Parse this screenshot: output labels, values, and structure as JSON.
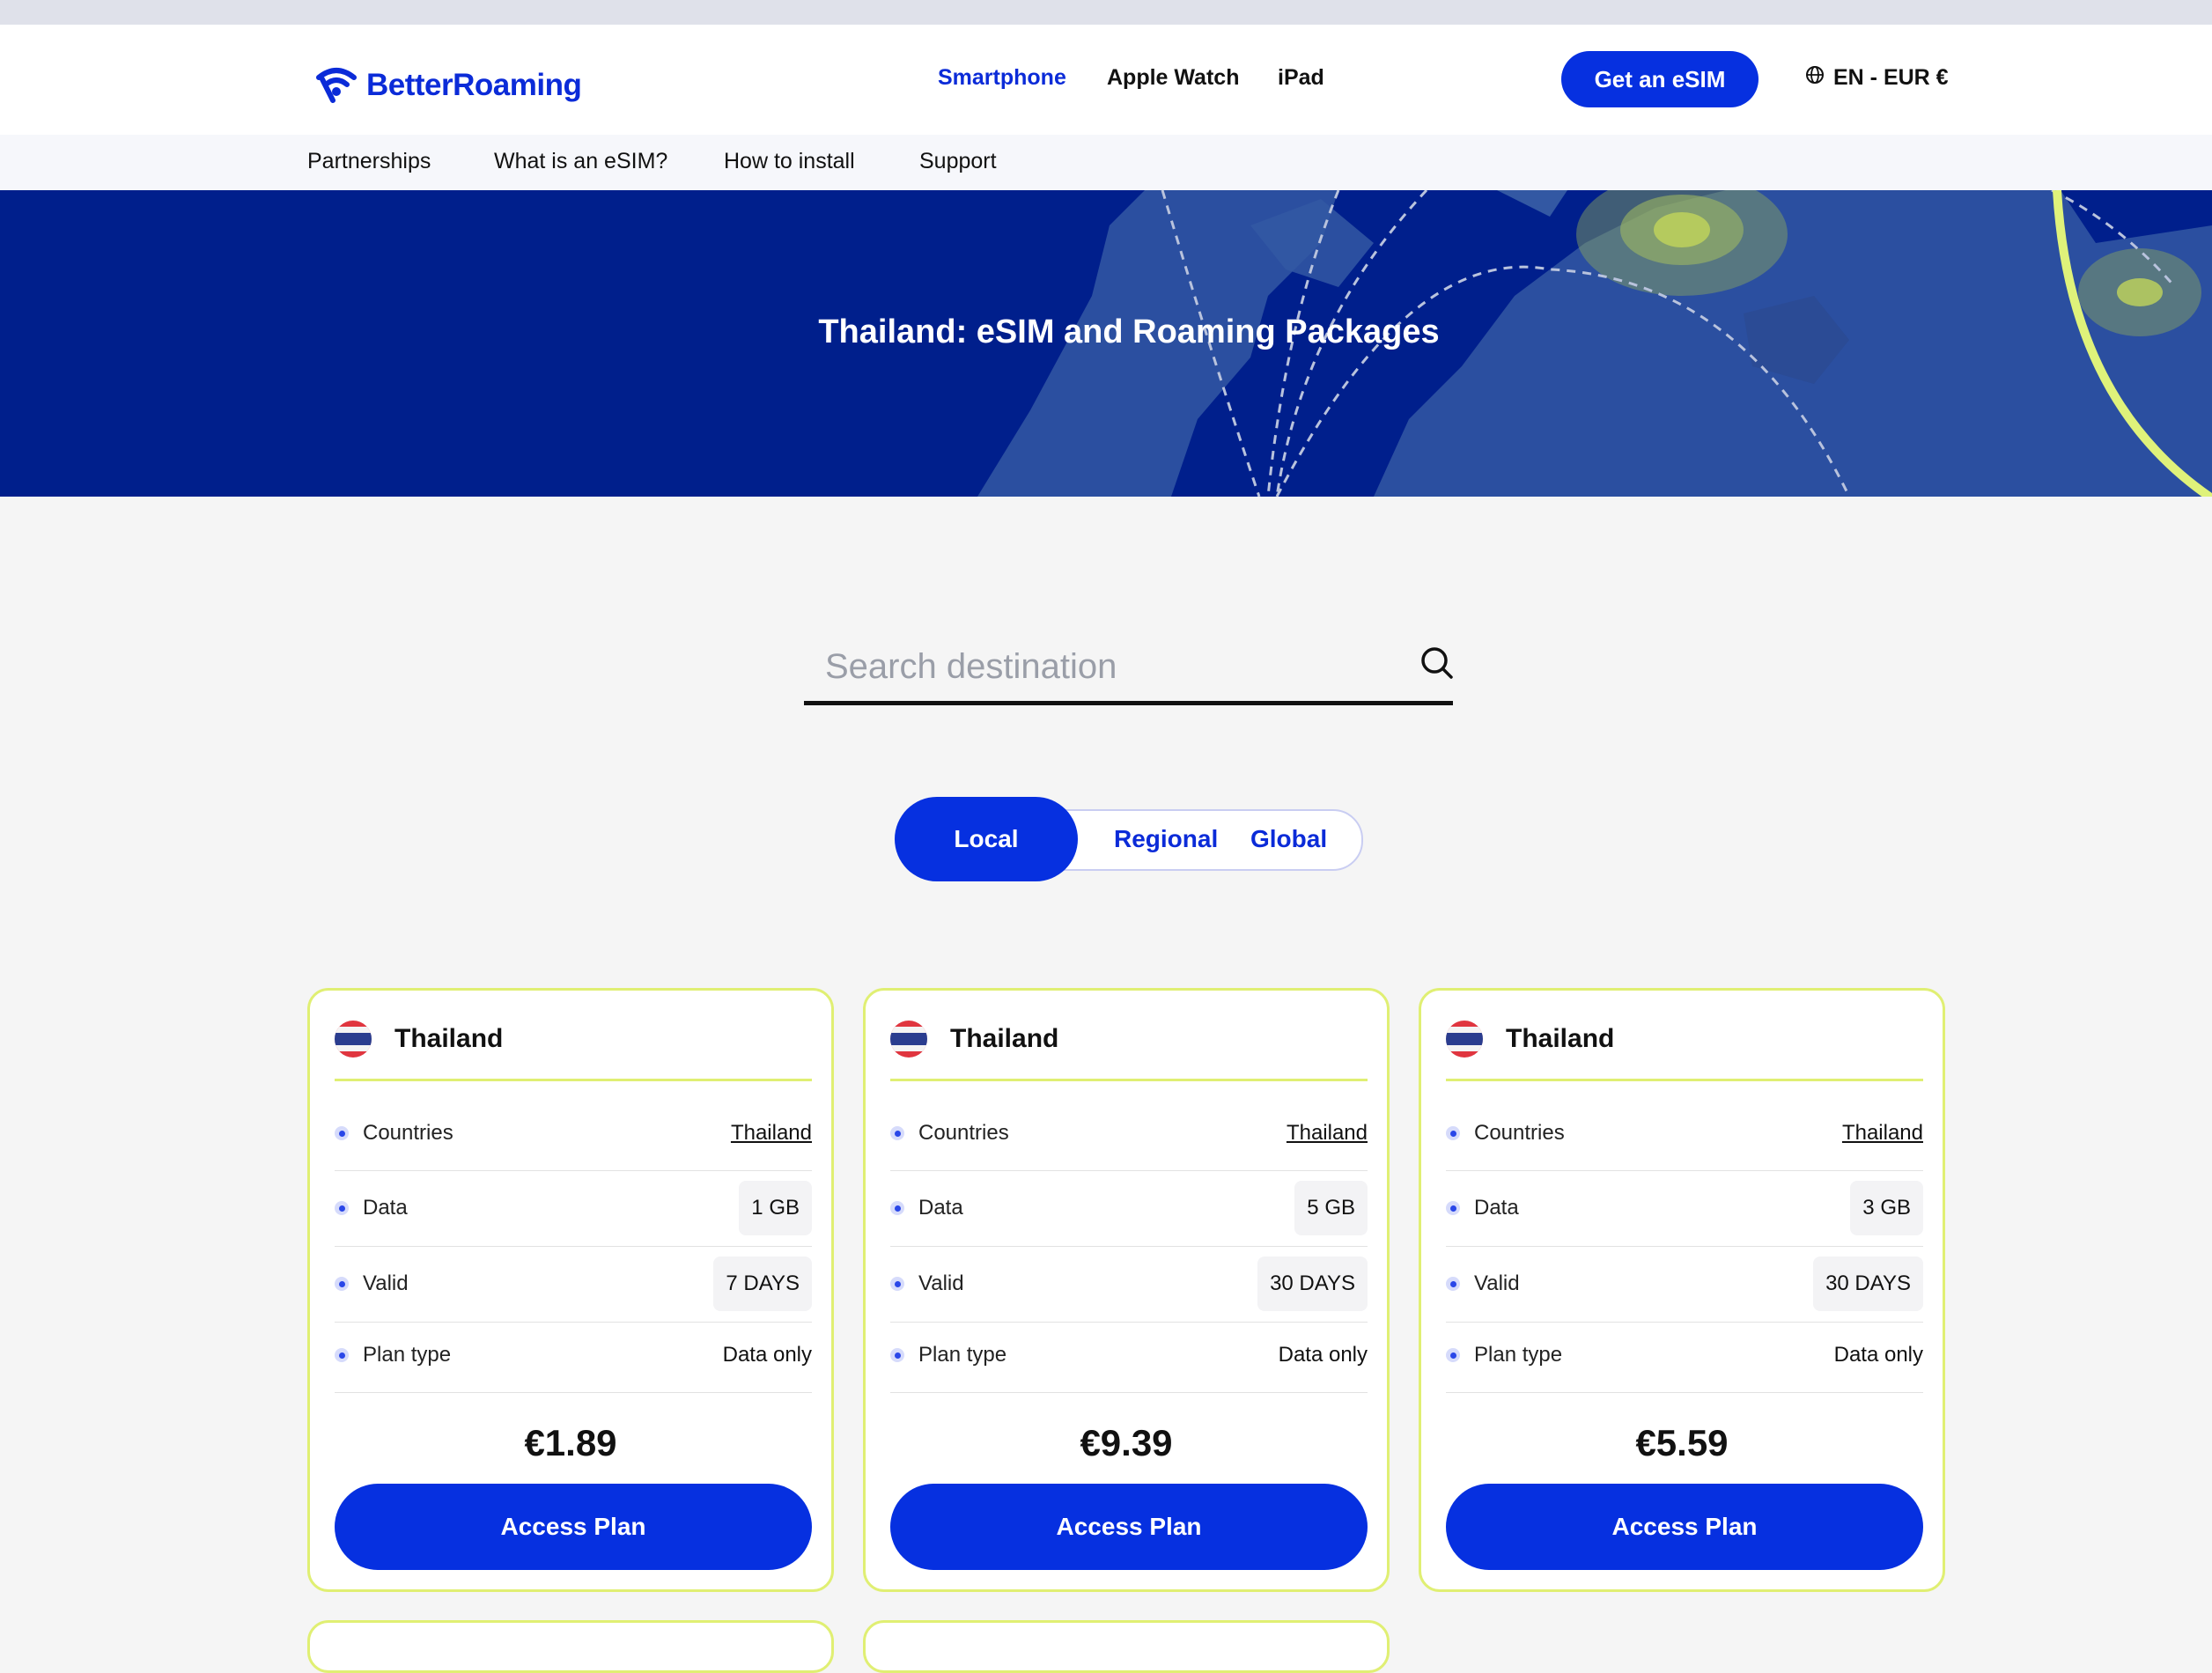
{
  "header": {
    "logo_text": "BetterRoaming",
    "nav": [
      "Smartphone",
      "Apple Watch",
      "iPad"
    ],
    "cta_label": "Get an eSIM",
    "lang_label": "EN - EUR €"
  },
  "subnav": [
    "Partnerships",
    "What is an eSIM?",
    "How to install",
    "Support"
  ],
  "hero": {
    "title": "Thailand: eSIM and Roaming Packages"
  },
  "search": {
    "placeholder": "Search destination"
  },
  "tabs": [
    "Local",
    "Regional",
    "Global"
  ],
  "labels": {
    "countries": "Countries",
    "data": "Data",
    "valid": "Valid",
    "plan_type": "Plan type",
    "access": "Access Plan"
  },
  "plans": [
    {
      "country": "Thailand",
      "countries": "Thailand",
      "data": "1 GB",
      "valid": "7 DAYS",
      "plan_type": "Data only",
      "price": "€1.89"
    },
    {
      "country": "Thailand",
      "countries": "Thailand",
      "data": "5 GB",
      "valid": "30 DAYS",
      "plan_type": "Data only",
      "price": "€9.39"
    },
    {
      "country": "Thailand",
      "countries": "Thailand",
      "data": "3 GB",
      "valid": "30 DAYS",
      "plan_type": "Data only",
      "price": "€5.59"
    }
  ],
  "colors": {
    "brand_blue": "#0630e0",
    "hero_navy": "#001f8c",
    "lime_accent": "#e0ef73"
  }
}
